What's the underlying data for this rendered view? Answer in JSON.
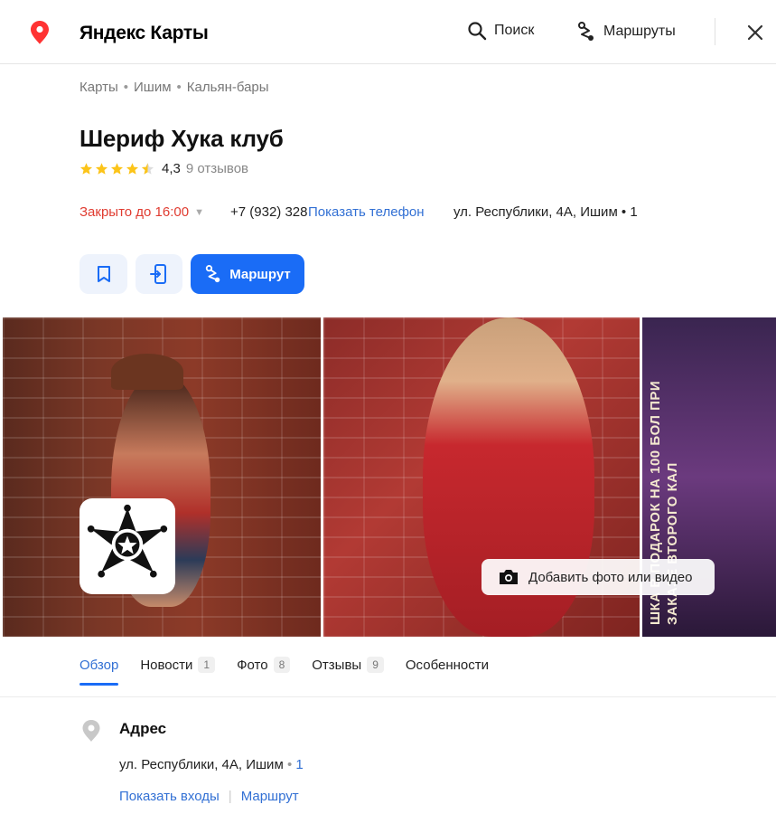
{
  "header": {
    "brand": "Яндекс Карты",
    "search_label": "Поиск",
    "routes_label": "Маршруты"
  },
  "breadcrumbs": [
    "Карты",
    "Ишим",
    "Кальян-бары"
  ],
  "place": {
    "name": "Шериф Хука клуб",
    "rating": "4,3",
    "rating_stars": 4.5,
    "reviews": "9 отзывов",
    "status": "Закрыто до 16:00",
    "phone_partial": "+7 (932) 328",
    "show_phone": "Показать телефон",
    "address_short": "ул. Республики, 4А, Ишим • 1"
  },
  "actions": {
    "route_label": "Маршрут"
  },
  "photos": {
    "add_label": "Добавить фото или видео",
    "promo_text": "ШКА В ПОДАРОК НА 100 БОЛ ПРИ ЗАКАЗЕ ВТОРОГО КАЛ"
  },
  "tabs": [
    {
      "label": "Обзор",
      "count": ""
    },
    {
      "label": "Новости",
      "count": "1"
    },
    {
      "label": "Фото",
      "count": "8"
    },
    {
      "label": "Отзывы",
      "count": "9"
    },
    {
      "label": "Особенности",
      "count": ""
    }
  ],
  "address_section": {
    "heading": "Адрес",
    "full": "ул. Республики, 4А, Ишим",
    "entrances_count": "1",
    "show_entrances": "Показать входы",
    "route": "Маршрут"
  },
  "colors": {
    "accent": "#1a6cf6",
    "link": "#3270d4",
    "closed": "#e03c31",
    "star": "#fcc419"
  }
}
